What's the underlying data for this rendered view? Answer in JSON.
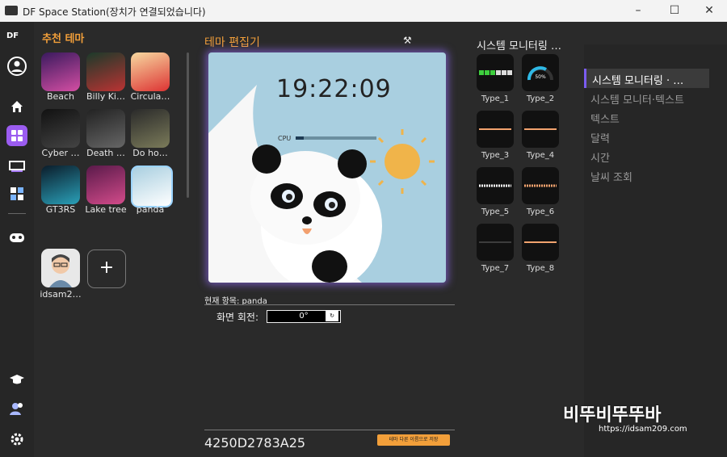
{
  "window": {
    "title": "DF Space Station(장치가 연결되었습니다)",
    "minimize": "–",
    "maximize": "☐",
    "close": "✕"
  },
  "nav": {
    "logo_text": "DF",
    "items": [
      {
        "name": "profile-icon",
        "glyph": "●"
      },
      {
        "name": "home-icon",
        "glyph": "⌂"
      },
      {
        "name": "theme-icon",
        "glyph": "▦"
      },
      {
        "name": "display-icon",
        "glyph": "▭"
      },
      {
        "name": "gallery-icon",
        "glyph": "▣"
      },
      {
        "name": "gamepad-icon",
        "glyph": "◉"
      },
      {
        "name": "education-icon",
        "glyph": "▲"
      },
      {
        "name": "users-icon",
        "glyph": "☺"
      },
      {
        "name": "settings-icon",
        "glyph": "⚙"
      }
    ]
  },
  "recommended": {
    "title": "추천 테마",
    "tiles": [
      {
        "label": "Beach",
        "colors": [
          "#3a1a5e",
          "#d44ea3"
        ]
      },
      {
        "label": "Billy Ki…",
        "colors": [
          "#1b3a2a",
          "#b33"
        ]
      },
      {
        "label": "Circula…",
        "colors": [
          "#f7d9a0",
          "#d33"
        ]
      },
      {
        "label": "Cyber …",
        "colors": [
          "#111",
          "#444"
        ]
      },
      {
        "label": "Death …",
        "colors": [
          "#222",
          "#666"
        ]
      },
      {
        "label": "Do ho…",
        "colors": [
          "#2a2a2a",
          "#7b7b5a"
        ]
      },
      {
        "label": "GT3RS",
        "colors": [
          "#0b1c2a",
          "#2aa0b8"
        ]
      },
      {
        "label": "Lake tree",
        "colors": [
          "#5a1a4a",
          "#d24b8a"
        ]
      },
      {
        "label": "panda",
        "colors": [
          "#a9cfe0",
          "#ffffff"
        ]
      }
    ],
    "user_tile_label": "idsam2…",
    "add_label": "+"
  },
  "editor": {
    "title": "테마 편집기",
    "tool_icon": "⚒",
    "clock": "19:22:09",
    "cpu_label": "CPU",
    "cpu_percent": 0.1,
    "current_item": "현재 항목: panda",
    "rotation_label": "화면 회전:",
    "rotation_value": "0°",
    "serial": "4250D2783A25",
    "save_label": "테마 다른 이름으로 저장"
  },
  "monitor": {
    "title": "시스템 모니터링 …",
    "types": [
      "Type_1",
      "Type_2",
      "Type_3",
      "Type_4",
      "Type_5",
      "Type_6",
      "Type_7",
      "Type_8"
    ],
    "type2_value": "50%"
  },
  "categories": {
    "items": [
      "시스템 모니터링 · …",
      "시스템 모니터·텍스트",
      "텍스트",
      "달력",
      "시간",
      "날씨 조회"
    ],
    "active_index": 0
  },
  "watermark": {
    "brand": "비뚜비뚜뚜바",
    "url": "https://idsam209.com"
  }
}
